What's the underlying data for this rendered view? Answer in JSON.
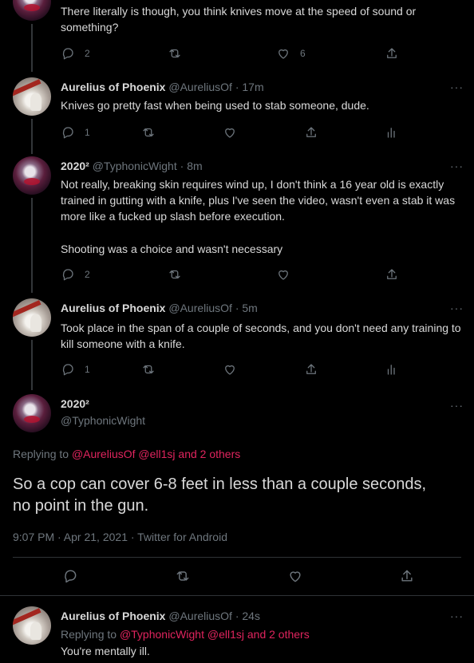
{
  "tweets": [
    {
      "text": "There literally is though, you think knives move at the speed of sound or something?",
      "reply_count": "2",
      "like_count": "6"
    },
    {
      "name": "Aurelius of Phoenix",
      "handle": "@AureliusOf",
      "time": "· 17m",
      "text": "Knives go pretty fast when being used to stab someone, dude.",
      "reply_count": "1"
    },
    {
      "name": "2020²",
      "handle": "@TyphonicWight",
      "time": "· 8m",
      "text_p1": "Not really, breaking skin requires wind up, I don't think a 16 year old is exactly trained in gutting with a knife, plus I've seen the video, wasn't even a stab it was more like a fucked up slash before execution.",
      "text_p2": "Shooting was a choice and wasn't necessary",
      "reply_count": "2"
    },
    {
      "name": "Aurelius of Phoenix",
      "handle": "@AureliusOf",
      "time": "· 5m",
      "text": "Took place in the span of a couple of seconds, and you don't need any training to kill someone with a knife.",
      "reply_count": "1"
    }
  ],
  "main": {
    "name": "2020²",
    "handle": "@TyphonicWight",
    "replying_prefix": "Replying to",
    "replying_handles": "@AureliusOf @ell1sj",
    "replying_and": "and",
    "replying_others": "2 others",
    "text": "So a cop can cover 6-8 feet in less than a couple seconds, no point in the gun.",
    "meta": "9:07 PM · Apr 21, 2021 · Twitter for Android"
  },
  "reply": {
    "name": "Aurelius of Phoenix",
    "handle": "@AureliusOf",
    "time": "· 24s",
    "replying_prefix": "Replying to",
    "replying_handles": "@TyphonicWight @ell1sj",
    "replying_and": "and",
    "replying_others": "2 others",
    "text": "You're mentally ill."
  },
  "more_label": "···",
  "colors": {
    "background": "#000000",
    "text": "#d9d9d9",
    "muted": "#6e767d",
    "link": "#e0245e",
    "divider": "#2f3336"
  }
}
